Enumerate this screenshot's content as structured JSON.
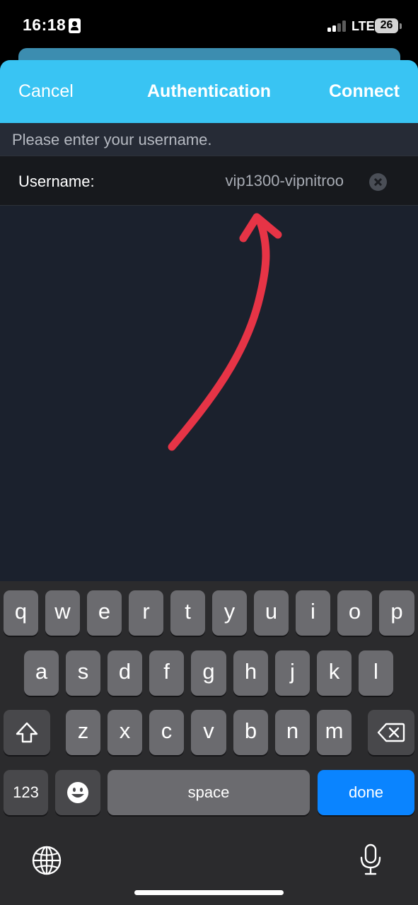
{
  "status_bar": {
    "time": "16:18",
    "network": "LTE",
    "battery": "26"
  },
  "nav": {
    "cancel": "Cancel",
    "title": "Authentication",
    "connect": "Connect"
  },
  "form": {
    "prompt": "Please enter your username.",
    "username_label": "Username:",
    "username_value": "vip1300-vipnitroo"
  },
  "keyboard": {
    "row1": [
      "q",
      "w",
      "e",
      "r",
      "t",
      "y",
      "u",
      "i",
      "o",
      "p"
    ],
    "row2": [
      "a",
      "s",
      "d",
      "f",
      "g",
      "h",
      "j",
      "k",
      "l"
    ],
    "row3": [
      "z",
      "x",
      "c",
      "v",
      "b",
      "n",
      "m"
    ],
    "numbers_key": "123",
    "space_key": "space",
    "done_key": "done",
    "icons": [
      "shift-icon",
      "backspace-icon",
      "emoji-icon",
      "globe-icon",
      "microphone-icon"
    ]
  },
  "colors": {
    "header": "#39c4f3",
    "done": "#0a84ff",
    "arrow": "#e63446",
    "background": "#1b212d"
  }
}
